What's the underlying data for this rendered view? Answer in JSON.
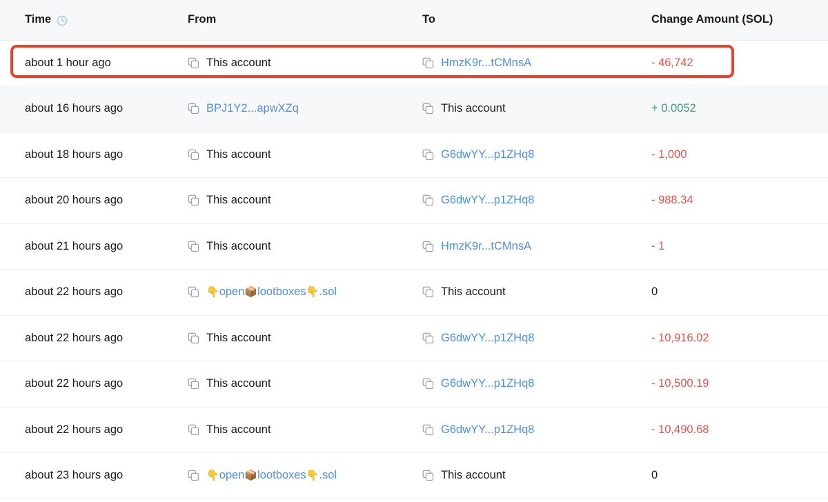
{
  "table": {
    "columns": [
      {
        "key": "time",
        "label": "Time",
        "icon": "clock-icon"
      },
      {
        "key": "from",
        "label": "From",
        "icon": null
      },
      {
        "key": "to",
        "label": "To",
        "icon": null
      },
      {
        "key": "amount",
        "label": "Change Amount (SOL)",
        "icon": null
      }
    ],
    "rows": [
      {
        "time": "about 1 hour ago",
        "from": {
          "text": "This account",
          "kind": "account"
        },
        "to": {
          "text": "HmzK9r...tCMnsA",
          "kind": "address"
        },
        "amount": {
          "text": "- 46,742",
          "sign": "negative"
        },
        "striped": false,
        "highlighted": true
      },
      {
        "time": "about 16 hours ago",
        "from": {
          "text": "BPJ1Y2...apwXZq",
          "kind": "address"
        },
        "to": {
          "text": "This account",
          "kind": "account"
        },
        "amount": {
          "text": "+ 0.0052",
          "sign": "positive"
        },
        "striped": true,
        "highlighted": false
      },
      {
        "time": "about 18 hours ago",
        "from": {
          "text": "This account",
          "kind": "account"
        },
        "to": {
          "text": "G6dwYY...p1ZHq8",
          "kind": "address"
        },
        "amount": {
          "text": "- 1,000",
          "sign": "negative"
        },
        "striped": false,
        "highlighted": false
      },
      {
        "time": "about 20 hours ago",
        "from": {
          "text": "This account",
          "kind": "account"
        },
        "to": {
          "text": "G6dwYY...p1ZHq8",
          "kind": "address"
        },
        "amount": {
          "text": "- 988.34",
          "sign": "negative"
        },
        "striped": false,
        "highlighted": false
      },
      {
        "time": "about 21 hours ago",
        "from": {
          "text": "This account",
          "kind": "account"
        },
        "to": {
          "text": "HmzK9r...tCMnsA",
          "kind": "address"
        },
        "amount": {
          "text": "- 1",
          "sign": "negative"
        },
        "striped": false,
        "highlighted": false
      },
      {
        "time": "about 22 hours ago",
        "from": {
          "text": "👇open📦lootboxes👇.sol",
          "kind": "address-emoji"
        },
        "to": {
          "text": "This account",
          "kind": "account"
        },
        "amount": {
          "text": "0",
          "sign": "zero"
        },
        "striped": false,
        "highlighted": false
      },
      {
        "time": "about 22 hours ago",
        "from": {
          "text": "This account",
          "kind": "account"
        },
        "to": {
          "text": "G6dwYY...p1ZHq8",
          "kind": "address"
        },
        "amount": {
          "text": "- 10,916.02",
          "sign": "negative"
        },
        "striped": false,
        "highlighted": false
      },
      {
        "time": "about 22 hours ago",
        "from": {
          "text": "This account",
          "kind": "account"
        },
        "to": {
          "text": "G6dwYY...p1ZHq8",
          "kind": "address"
        },
        "amount": {
          "text": "- 10,500.19",
          "sign": "negative"
        },
        "striped": false,
        "highlighted": false
      },
      {
        "time": "about 22 hours ago",
        "from": {
          "text": "This account",
          "kind": "account"
        },
        "to": {
          "text": "G6dwYY...p1ZHq8",
          "kind": "address"
        },
        "amount": {
          "text": "- 10,490.68",
          "sign": "negative"
        },
        "striped": false,
        "highlighted": false
      },
      {
        "time": "about 23 hours ago",
        "from": {
          "text": "👇open📦lootboxes👇.sol",
          "kind": "address-emoji"
        },
        "to": {
          "text": "This account",
          "kind": "account"
        },
        "amount": {
          "text": "0",
          "sign": "zero"
        },
        "striped": false,
        "highlighted": false
      }
    ]
  },
  "colors": {
    "accent_link": "#4a90e2",
    "negative": "#e0554a",
    "positive": "#34a07a",
    "header_bg": "#f7f8f9",
    "highlight_border": "#e8432a",
    "text": "#1b1b1f"
  },
  "annotation": {
    "highlight_row_index": 0,
    "highlight_label": "red-highlight-box"
  }
}
